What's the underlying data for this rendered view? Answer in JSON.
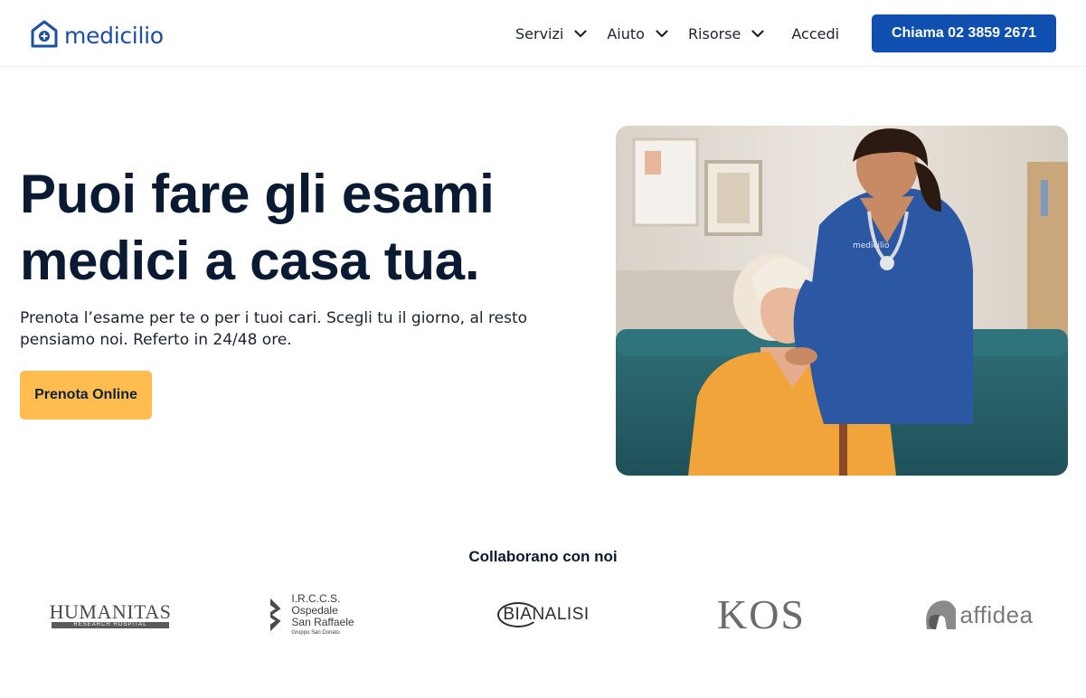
{
  "header": {
    "logo_text": "medicilio",
    "nav": [
      {
        "label": "Servizi",
        "has_dropdown": true
      },
      {
        "label": "Aiuto",
        "has_dropdown": true
      },
      {
        "label": "Risorse",
        "has_dropdown": true
      },
      {
        "label": "Accedi",
        "has_dropdown": false
      }
    ],
    "call_button": "Chiama 02 3859 2671"
  },
  "hero": {
    "title_line1": "Puoi fare gli esami",
    "title_line2": "medici a casa tua.",
    "subtitle": "Prenota l’esame per te o per i tuoi cari. Scegli tu il giorno, al resto pensiamo noi. Referto in 24/48 ore.",
    "cta": "Prenota Online",
    "image_uniform_logo": "medicilio"
  },
  "partners": {
    "title": "Collaborano con noi",
    "logos": [
      {
        "name": "HUMANITAS",
        "tagline": "RESEARCH HOSPITAL"
      },
      {
        "name": "I.R.C.C.S. Ospedale",
        "name2": "San Raffaele",
        "tagline": "Gruppo San Donato"
      },
      {
        "name": "BIANALISI"
      },
      {
        "name": "KOS"
      },
      {
        "name": "affidea"
      }
    ]
  },
  "colors": {
    "brand_blue": "#0e4fb0",
    "cta_yellow": "#ffbd4f",
    "text_dark": "#0a1a33"
  }
}
